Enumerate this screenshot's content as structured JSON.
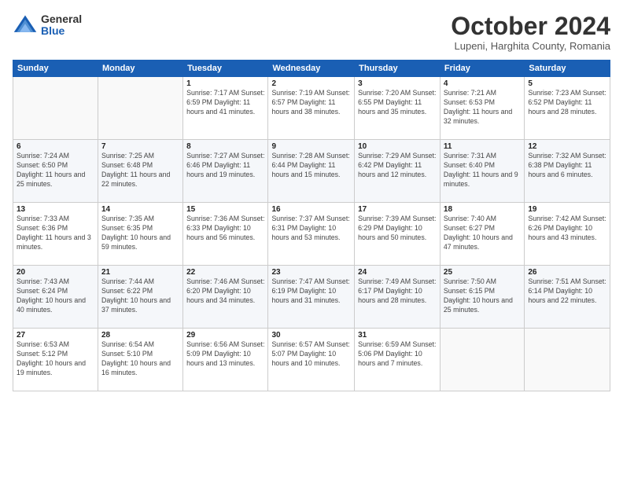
{
  "logo": {
    "general": "General",
    "blue": "Blue"
  },
  "header": {
    "month": "October 2024",
    "location": "Lupeni, Harghita County, Romania"
  },
  "weekdays": [
    "Sunday",
    "Monday",
    "Tuesday",
    "Wednesday",
    "Thursday",
    "Friday",
    "Saturday"
  ],
  "weeks": [
    [
      {
        "day": "",
        "detail": ""
      },
      {
        "day": "",
        "detail": ""
      },
      {
        "day": "1",
        "detail": "Sunrise: 7:17 AM\nSunset: 6:59 PM\nDaylight: 11 hours and 41 minutes."
      },
      {
        "day": "2",
        "detail": "Sunrise: 7:19 AM\nSunset: 6:57 PM\nDaylight: 11 hours and 38 minutes."
      },
      {
        "day": "3",
        "detail": "Sunrise: 7:20 AM\nSunset: 6:55 PM\nDaylight: 11 hours and 35 minutes."
      },
      {
        "day": "4",
        "detail": "Sunrise: 7:21 AM\nSunset: 6:53 PM\nDaylight: 11 hours and 32 minutes."
      },
      {
        "day": "5",
        "detail": "Sunrise: 7:23 AM\nSunset: 6:52 PM\nDaylight: 11 hours and 28 minutes."
      }
    ],
    [
      {
        "day": "6",
        "detail": "Sunrise: 7:24 AM\nSunset: 6:50 PM\nDaylight: 11 hours and 25 minutes."
      },
      {
        "day": "7",
        "detail": "Sunrise: 7:25 AM\nSunset: 6:48 PM\nDaylight: 11 hours and 22 minutes."
      },
      {
        "day": "8",
        "detail": "Sunrise: 7:27 AM\nSunset: 6:46 PM\nDaylight: 11 hours and 19 minutes."
      },
      {
        "day": "9",
        "detail": "Sunrise: 7:28 AM\nSunset: 6:44 PM\nDaylight: 11 hours and 15 minutes."
      },
      {
        "day": "10",
        "detail": "Sunrise: 7:29 AM\nSunset: 6:42 PM\nDaylight: 11 hours and 12 minutes."
      },
      {
        "day": "11",
        "detail": "Sunrise: 7:31 AM\nSunset: 6:40 PM\nDaylight: 11 hours and 9 minutes."
      },
      {
        "day": "12",
        "detail": "Sunrise: 7:32 AM\nSunset: 6:38 PM\nDaylight: 11 hours and 6 minutes."
      }
    ],
    [
      {
        "day": "13",
        "detail": "Sunrise: 7:33 AM\nSunset: 6:36 PM\nDaylight: 11 hours and 3 minutes."
      },
      {
        "day": "14",
        "detail": "Sunrise: 7:35 AM\nSunset: 6:35 PM\nDaylight: 10 hours and 59 minutes."
      },
      {
        "day": "15",
        "detail": "Sunrise: 7:36 AM\nSunset: 6:33 PM\nDaylight: 10 hours and 56 minutes."
      },
      {
        "day": "16",
        "detail": "Sunrise: 7:37 AM\nSunset: 6:31 PM\nDaylight: 10 hours and 53 minutes."
      },
      {
        "day": "17",
        "detail": "Sunrise: 7:39 AM\nSunset: 6:29 PM\nDaylight: 10 hours and 50 minutes."
      },
      {
        "day": "18",
        "detail": "Sunrise: 7:40 AM\nSunset: 6:27 PM\nDaylight: 10 hours and 47 minutes."
      },
      {
        "day": "19",
        "detail": "Sunrise: 7:42 AM\nSunset: 6:26 PM\nDaylight: 10 hours and 43 minutes."
      }
    ],
    [
      {
        "day": "20",
        "detail": "Sunrise: 7:43 AM\nSunset: 6:24 PM\nDaylight: 10 hours and 40 minutes."
      },
      {
        "day": "21",
        "detail": "Sunrise: 7:44 AM\nSunset: 6:22 PM\nDaylight: 10 hours and 37 minutes."
      },
      {
        "day": "22",
        "detail": "Sunrise: 7:46 AM\nSunset: 6:20 PM\nDaylight: 10 hours and 34 minutes."
      },
      {
        "day": "23",
        "detail": "Sunrise: 7:47 AM\nSunset: 6:19 PM\nDaylight: 10 hours and 31 minutes."
      },
      {
        "day": "24",
        "detail": "Sunrise: 7:49 AM\nSunset: 6:17 PM\nDaylight: 10 hours and 28 minutes."
      },
      {
        "day": "25",
        "detail": "Sunrise: 7:50 AM\nSunset: 6:15 PM\nDaylight: 10 hours and 25 minutes."
      },
      {
        "day": "26",
        "detail": "Sunrise: 7:51 AM\nSunset: 6:14 PM\nDaylight: 10 hours and 22 minutes."
      }
    ],
    [
      {
        "day": "27",
        "detail": "Sunrise: 6:53 AM\nSunset: 5:12 PM\nDaylight: 10 hours and 19 minutes."
      },
      {
        "day": "28",
        "detail": "Sunrise: 6:54 AM\nSunset: 5:10 PM\nDaylight: 10 hours and 16 minutes."
      },
      {
        "day": "29",
        "detail": "Sunrise: 6:56 AM\nSunset: 5:09 PM\nDaylight: 10 hours and 13 minutes."
      },
      {
        "day": "30",
        "detail": "Sunrise: 6:57 AM\nSunset: 5:07 PM\nDaylight: 10 hours and 10 minutes."
      },
      {
        "day": "31",
        "detail": "Sunrise: 6:59 AM\nSunset: 5:06 PM\nDaylight: 10 hours and 7 minutes."
      },
      {
        "day": "",
        "detail": ""
      },
      {
        "day": "",
        "detail": ""
      }
    ]
  ]
}
